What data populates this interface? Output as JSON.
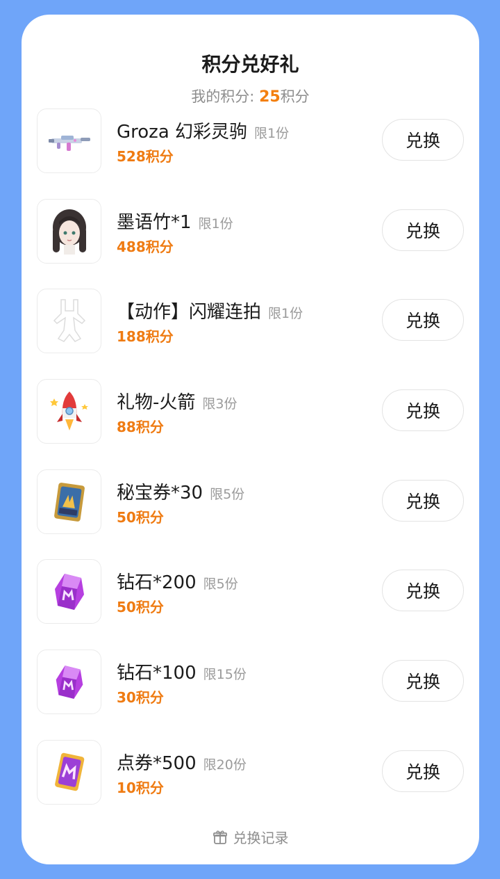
{
  "header": {
    "title": "积分兑好礼",
    "points_label": "我的积分: ",
    "points_value": "25",
    "points_unit": "积分"
  },
  "items": [
    {
      "name": "Groza 幻彩灵驹",
      "limit": "限1份",
      "cost": "528积分",
      "button": "兑换",
      "icon": "rifle-icon"
    },
    {
      "name": "墨语竹*1",
      "limit": "限1份",
      "cost": "488积分",
      "button": "兑换",
      "icon": "avatar-girl-icon"
    },
    {
      "name": "【动作】闪耀连拍",
      "limit": "限1份",
      "cost": "188积分",
      "button": "兑换",
      "icon": "pose-figure-icon"
    },
    {
      "name": "礼物-火箭",
      "limit": "限3份",
      "cost": "88积分",
      "button": "兑换",
      "icon": "rocket-icon"
    },
    {
      "name": "秘宝券*30",
      "limit": "限5份",
      "cost": "50积分",
      "button": "兑换",
      "icon": "treasure-card-icon"
    },
    {
      "name": "钻石*200",
      "limit": "限5份",
      "cost": "50积分",
      "button": "兑换",
      "icon": "diamond-icon"
    },
    {
      "name": "钻石*100",
      "limit": "限15份",
      "cost": "30积分",
      "button": "兑换",
      "icon": "diamond-icon"
    },
    {
      "name": "点券*500",
      "limit": "限20份",
      "cost": "10积分",
      "button": "兑换",
      "icon": "voucher-card-icon"
    }
  ],
  "footer": {
    "history_label": "兑换记录",
    "history_icon": "gift-box-icon"
  },
  "colors": {
    "background": "#6fa5f9",
    "accent_orange": "#ef7b12",
    "text_dark": "#1b1b1b",
    "text_gray": "#8d8d8d"
  }
}
